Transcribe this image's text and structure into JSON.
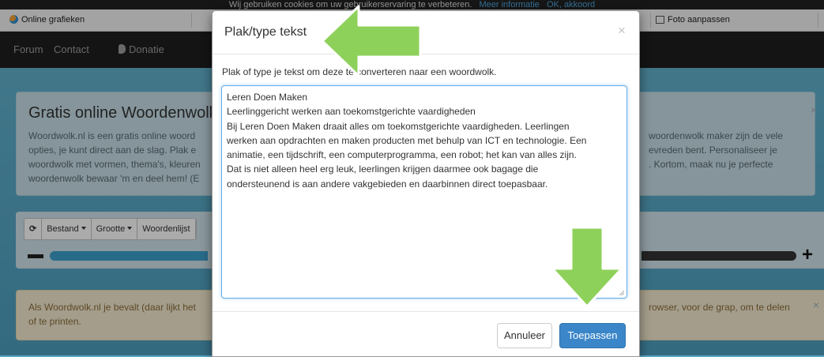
{
  "cookie_bar": {
    "text": "Wij gebruiken cookies om uw gebruikerservaring te verbeteren.",
    "link_more": "Meer informatie",
    "link_ok": "OK, akkoord"
  },
  "browser_tabs": {
    "left_label": "Online grafieken",
    "right_label": "Foto aanpassen"
  },
  "nav": {
    "forum": "Forum",
    "contact": "Contact",
    "donatie": "Donatie"
  },
  "intro": {
    "title": "Gratis online Woordenwolk",
    "left_lines": [
      "Woordwolk.nl is een gratis online woord",
      "opties, je kunt direct aan de slag. Plak e",
      "woordwolk met vormen, thema's, kleuren",
      "woordenwolk bewaar 'm en deel hem! (E"
    ],
    "right_lines": [
      "woordenwolk maker zijn de vele",
      "evreden bent. Personaliseer je",
      ". Kortom, maak nu je perfecte"
    ]
  },
  "toolbar": {
    "refresh_icon": "refresh-icon",
    "bestand": "Bestand",
    "grootte": "Grootte",
    "woordenlijst": "Woordenlijst"
  },
  "notice": {
    "left_lines": [
      "Als Woordwolk.nl je bevalt (daar lijkt het",
      "of te printen."
    ],
    "right_lines": [
      "rowser, voor de grap, om te delen"
    ]
  },
  "modal": {
    "title": "Plak/type tekst",
    "close": "×",
    "description": "Plak of type je tekst om deze te converteren naar een woordwolk.",
    "textarea_lines": [
      "Leren Doen Maken",
      "Leerlinggericht werken aan toekomstgerichte vaardigheden",
      "Bij Leren Doen Maken draait alles om toekomstgerichte vaardigheden. Leerlingen",
      "werken aan opdrachten en maken producten met behulp van ICT en technologie. Een",
      "animatie, een tijdschrift, een computerprogramma, een robot; het kan van alles zijn.",
      "Dat is niet alleen heel erg leuk, leerlingen krijgen daarmee ook bagage die",
      "ondersteunend is aan andere vakgebieden en daarbinnen direct toepasbaar."
    ],
    "cancel_label": "Annuleer",
    "apply_label": "Toepassen"
  },
  "colors": {
    "primary_button": "#3a86c8",
    "arrow_green": "#8ed15a"
  }
}
